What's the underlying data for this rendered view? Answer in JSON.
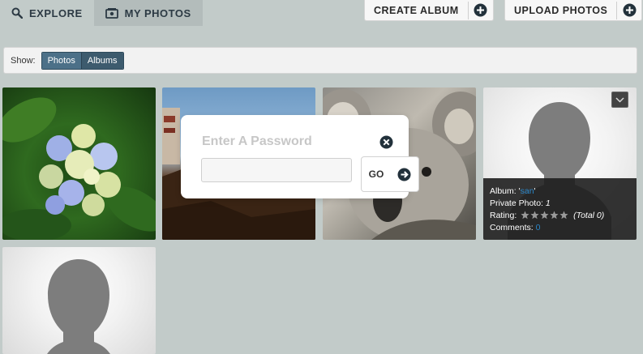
{
  "nav": {
    "explore_label": "EXPLORE",
    "my_photos_label": "MY PHOTOS",
    "create_album_label": "CREATE ALBUM",
    "upload_photos_label": "UPLOAD PHOTOS"
  },
  "filter": {
    "show_label": "Show:",
    "photos_label": "Photos",
    "albums_label": "Albums"
  },
  "photo_info": {
    "album_prefix": "Album: '",
    "album_name": "san",
    "album_suffix": "'",
    "private_label": "Private Photo:",
    "private_value": "1",
    "rating_label": "Rating:",
    "rating_total": "(Total 0)",
    "comments_label": "Comments:",
    "comments_value": "0"
  },
  "dialog": {
    "title": "Enter A Password",
    "password_value": "",
    "go_label": "GO"
  },
  "icons": {
    "explore": "search-icon",
    "my_photos": "photos-icon",
    "create_album": "plus-circle-icon",
    "upload_photos": "plus-circle-icon",
    "close": "close-circle-icon",
    "go": "arrow-right-circle-icon",
    "menu": "chevron-down-icon",
    "rating": "star-icon"
  },
  "colors": {
    "background": "#c2cbc9",
    "active_tab": "#b3bcbb",
    "segment": "#4c7088",
    "link": "#2a86c8",
    "dark_icon": "#22313b"
  }
}
